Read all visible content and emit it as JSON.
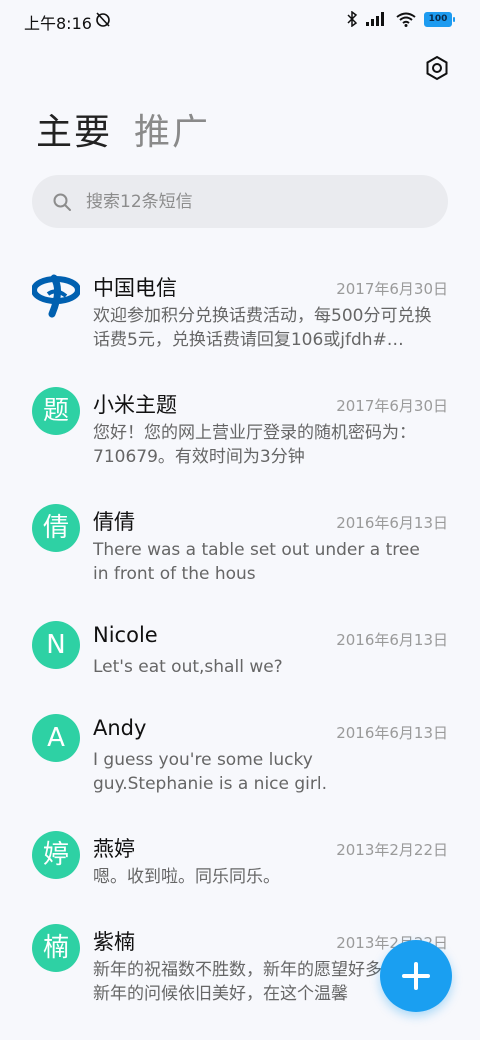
{
  "status_bar": {
    "time": "上午8:16",
    "battery": "100"
  },
  "tabs": [
    {
      "label": "主要",
      "active": true
    },
    {
      "label": "推广",
      "active": false
    }
  ],
  "search": {
    "placeholder": "搜索12条短信"
  },
  "conversations": [
    {
      "name": "中国电信",
      "date": "2017年6月30日",
      "preview": "欢迎参加积分兑换话费活动，每500分可兑换话费5元，兑换话费请回复106或jfdh#…",
      "avatar": "china-telecom-logo"
    },
    {
      "name": "小米主题",
      "date": "2017年6月30日",
      "preview": "您好！您的网上营业厅登录的随机密码为：710679。有效时间为3分钟",
      "avatar": "题"
    },
    {
      "name": "倩倩",
      "date": "2016年6月13日",
      "preview": "There was a table set out under a tree in front of the hous",
      "avatar": "倩"
    },
    {
      "name": "Nicole",
      "date": "2016年6月13日",
      "preview": "Let's eat out,shall we?",
      "avatar": "N"
    },
    {
      "name": "Andy",
      "date": "2016年6月13日",
      "preview": "I guess you're some lucky guy.Stephanie is a nice girl.",
      "avatar": "A"
    },
    {
      "name": "燕婷",
      "date": "2013年2月22日",
      "preview": "嗯。收到啦。同乐同乐。",
      "avatar": "婷"
    },
    {
      "name": "紫楠",
      "date": "2013年2月22日",
      "preview": "新年的祝福数不胜数，新年的愿望好多好多，新年的问候依旧美好，在这个温馨",
      "avatar": "楠"
    }
  ],
  "colors": {
    "avatar_bg": "#2ed1a4",
    "fab_bg": "#1a9ff1",
    "accent": "#1d9bf0"
  }
}
